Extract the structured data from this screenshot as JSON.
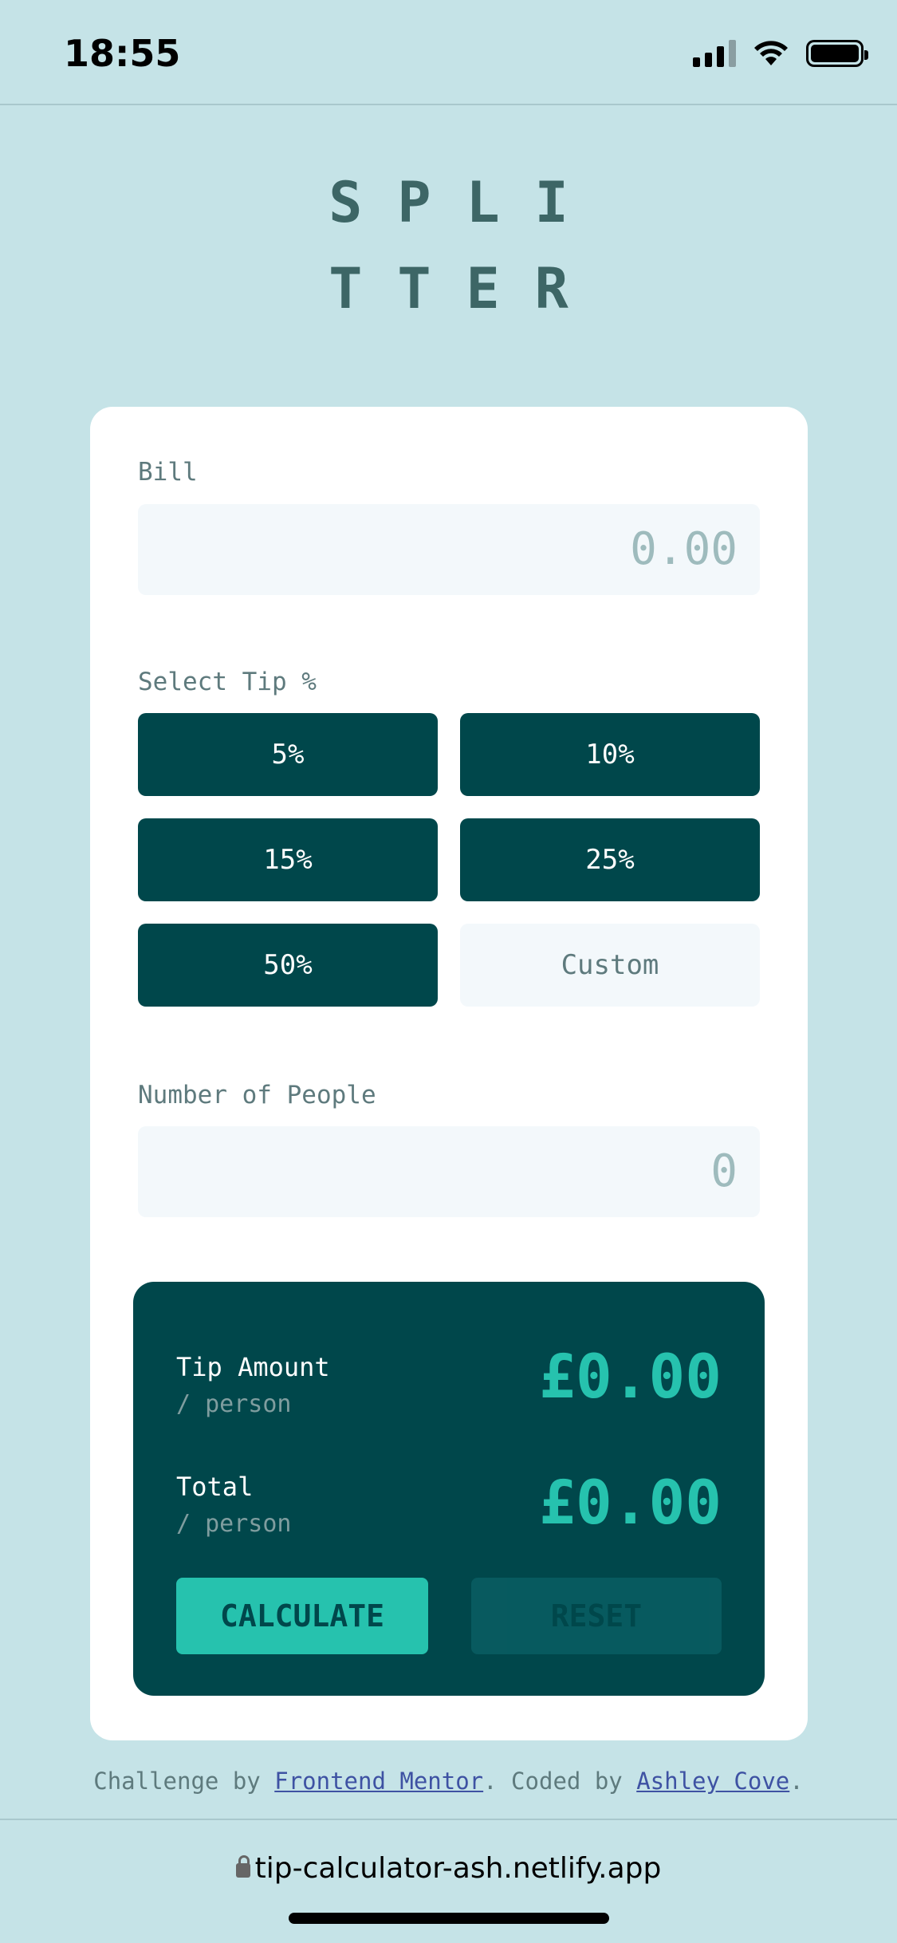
{
  "status_bar": {
    "time": "18:55"
  },
  "logo": {
    "line1": "SPLI",
    "line2": "TTER"
  },
  "bill": {
    "label": "Bill",
    "placeholder": "0.00"
  },
  "tip": {
    "label": "Select Tip %",
    "options": [
      "5%",
      "10%",
      "15%",
      "25%",
      "50%"
    ],
    "custom_placeholder": "Custom"
  },
  "people": {
    "label": "Number of People",
    "placeholder": "0"
  },
  "results": {
    "tip_title": "Tip Amount",
    "tip_sub": "/ person",
    "tip_value": "£0.00",
    "total_title": "Total",
    "total_sub": "/ person",
    "total_value": "£0.00"
  },
  "buttons": {
    "calculate": "CALCULATE",
    "reset": "RESET"
  },
  "footer": {
    "prefix": "Challenge by ",
    "link1": "Frontend Mentor",
    "middle": ". Coded by ",
    "link2": "Ashley Cove",
    "suffix": "."
  },
  "browser": {
    "url": "tip-calculator-ash.netlify.app"
  }
}
